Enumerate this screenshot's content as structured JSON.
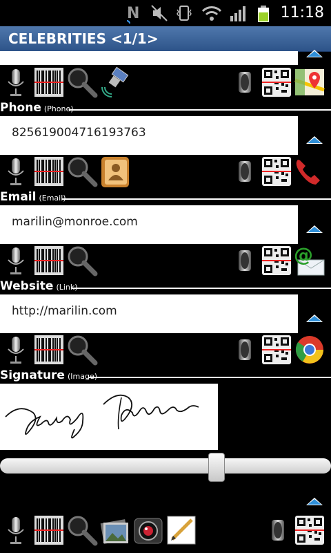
{
  "status": {
    "time": "11:18"
  },
  "title": "CELEBRITIES <1/1>",
  "sections": [
    {
      "key": "phone",
      "label": "Phone",
      "type": "(Phone)",
      "value": "825619004716193763"
    },
    {
      "key": "email",
      "label": "Email",
      "type": "(Email)",
      "value": "marilin@monroe.com"
    },
    {
      "key": "website",
      "label": "Website",
      "type": "(Link)",
      "value": "http://marilin.com"
    },
    {
      "key": "signature",
      "label": "Signature",
      "type": "(Image)",
      "value": "Marilyn Monroe"
    }
  ],
  "slider": {
    "value": 0.66
  },
  "icons": {
    "mic": "microphone-icon",
    "barcode": "barcode-icon",
    "search": "magnifier-icon",
    "satellite": "satellite-icon",
    "speaker": "speaker-icon",
    "qr": "qr-code-icon",
    "maps": "maps-icon",
    "contacts": "contacts-icon",
    "phone": "phone-call-icon",
    "email": "email-icon",
    "browser": "browser-icon",
    "gallery": "gallery-icon",
    "camera": "camera-icon",
    "draw": "draw-icon"
  }
}
